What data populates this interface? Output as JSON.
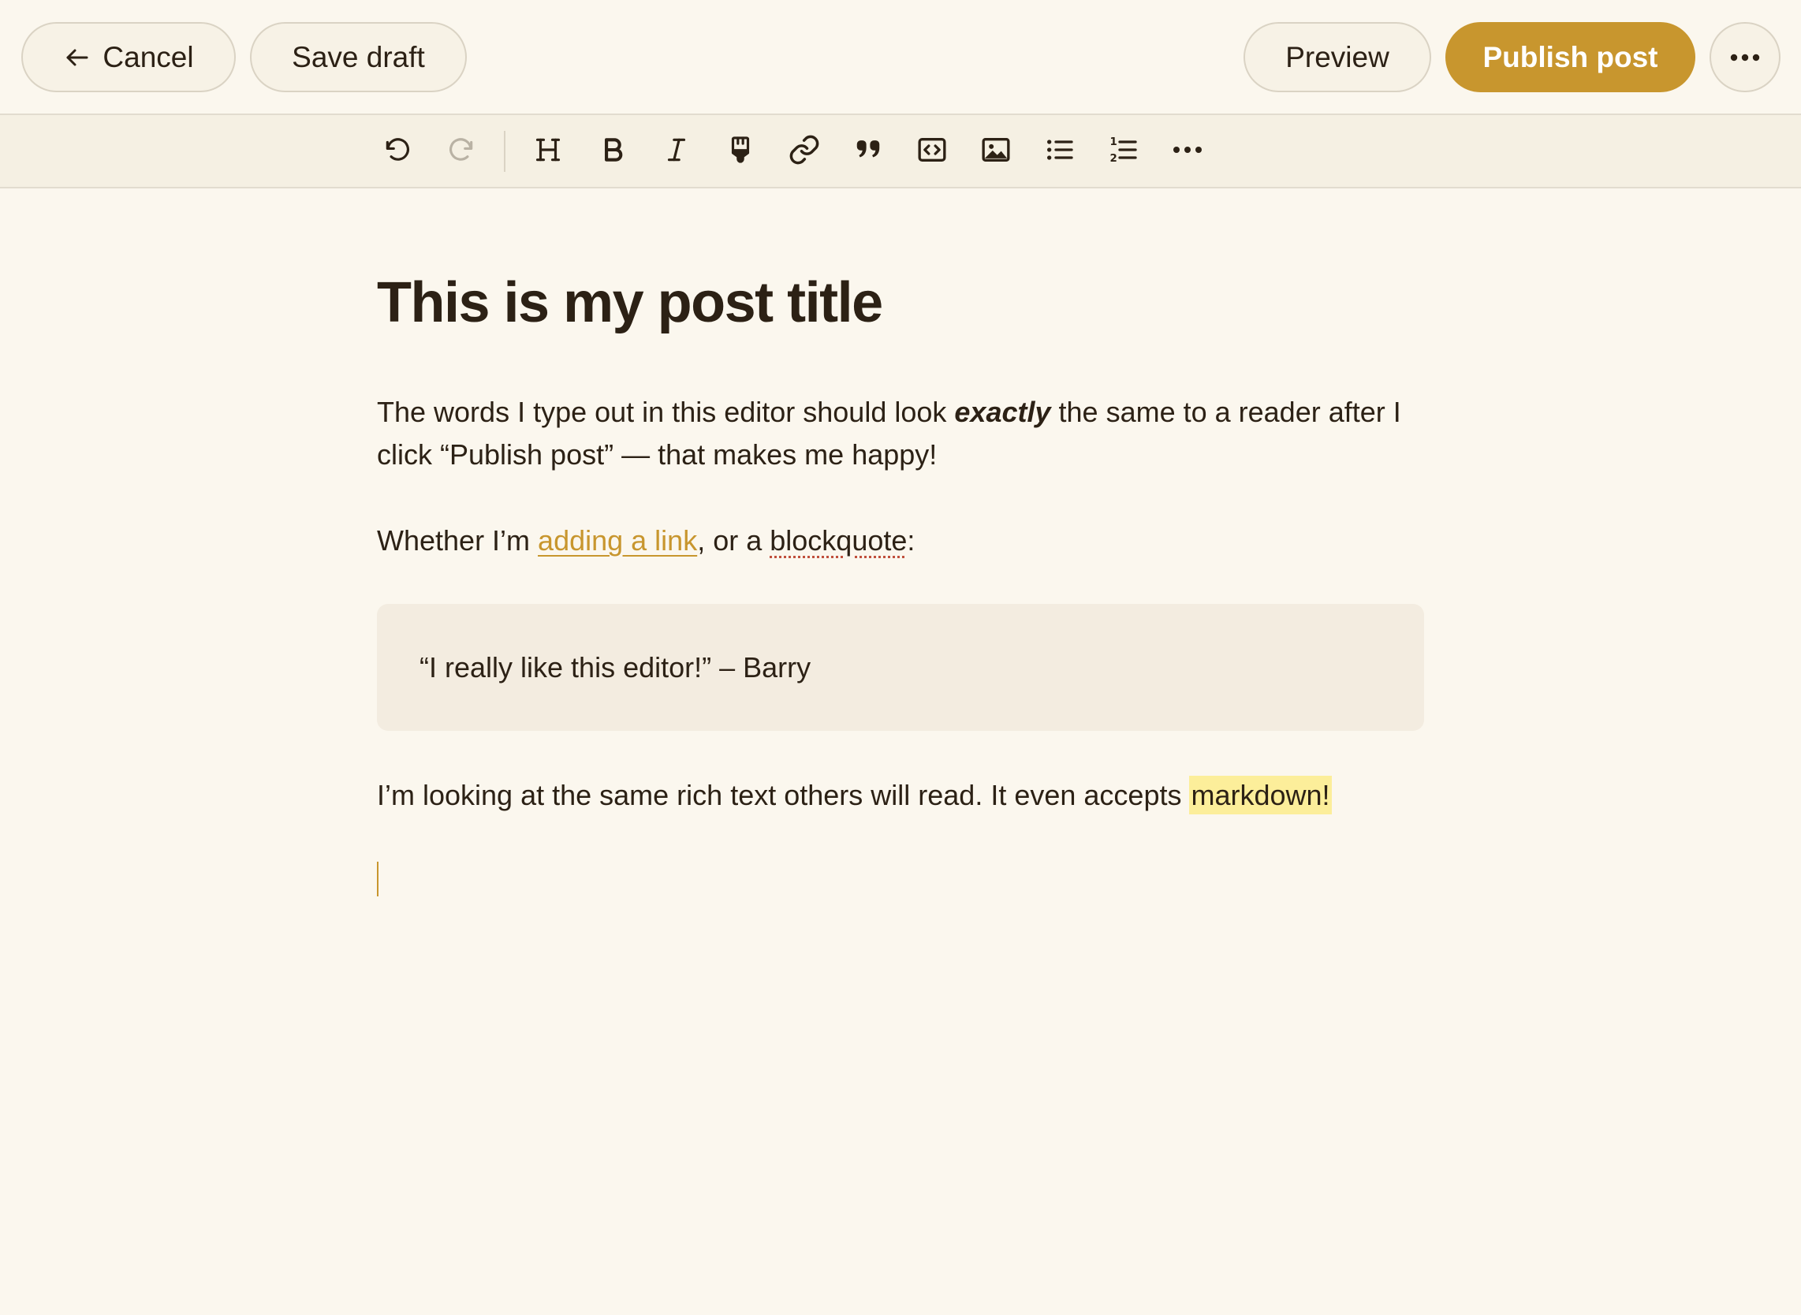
{
  "header": {
    "cancel_label": "Cancel",
    "save_draft_label": "Save draft",
    "preview_label": "Preview",
    "publish_label": "Publish post",
    "more_icon": "more-horizontal-icon"
  },
  "toolbar": {
    "buttons": [
      {
        "name": "undo",
        "icon": "undo-icon",
        "enabled": true
      },
      {
        "name": "redo",
        "icon": "redo-icon",
        "enabled": false
      },
      {
        "name": "heading",
        "icon": "heading-icon",
        "glyph": "H"
      },
      {
        "name": "bold",
        "icon": "bold-icon",
        "glyph": "B"
      },
      {
        "name": "italic",
        "icon": "italic-icon",
        "glyph": "I"
      },
      {
        "name": "highlight",
        "icon": "highlighter-icon"
      },
      {
        "name": "link",
        "icon": "link-icon"
      },
      {
        "name": "quote",
        "icon": "quote-icon"
      },
      {
        "name": "code",
        "icon": "code-icon"
      },
      {
        "name": "image",
        "icon": "image-icon"
      },
      {
        "name": "bullet-list",
        "icon": "bullet-list-icon"
      },
      {
        "name": "numbered-list",
        "icon": "numbered-list-icon"
      },
      {
        "name": "more",
        "icon": "more-horizontal-icon"
      }
    ]
  },
  "editor": {
    "title": "This is my post title",
    "para1": {
      "before": "The words I type out in this editor should look ",
      "emphasis": "exactly",
      "after": " the same to a reader after I click “Publish post” — that makes me happy!"
    },
    "para2": {
      "before": "Whether I’m ",
      "link": "adding a link",
      "middle": ", or a ",
      "misspelled": "blockquote",
      "after": ":"
    },
    "quote": "“I really like this editor!” – Barry",
    "para3": {
      "before": "I’m looking at the same rich text others will read. It even accepts ",
      "highlight": "markdown!"
    }
  },
  "colors": {
    "background": "#FBF7EE",
    "toolbar": "#F5F0E3",
    "accent": "#C8962E",
    "text": "#2C2115",
    "quote_bg": "#F3ECE0",
    "highlight": "#FCEE9A"
  }
}
